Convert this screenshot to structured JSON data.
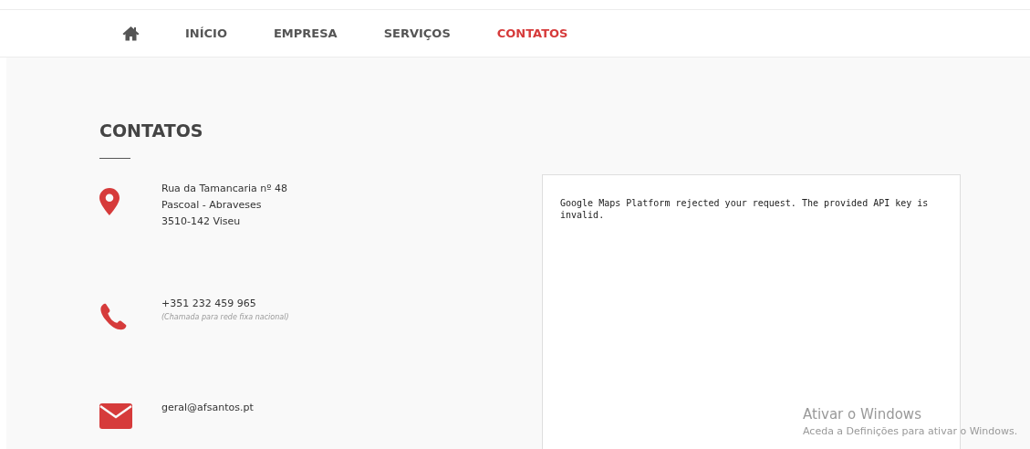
{
  "nav": {
    "items": [
      {
        "kind": "home",
        "selected": false
      },
      {
        "kind": "text",
        "label": "INÍCIO",
        "selected": false
      },
      {
        "kind": "text",
        "label": "EMPRESA",
        "selected": false
      },
      {
        "kind": "text",
        "label": "SERVIÇOS",
        "selected": false
      },
      {
        "kind": "text",
        "label": "CONTATOS",
        "selected": true
      }
    ]
  },
  "heading": "CONTATOS",
  "contacts": [
    {
      "kind": "address",
      "lines": [
        "Rua da Tamancaria nº 48",
        "Pascoal - Abraveses",
        "3510-142 Viseu"
      ]
    },
    {
      "kind": "phone",
      "lines": [
        "+351 232 459 965"
      ],
      "note": "(Chamada para rede fixa nacional)"
    },
    {
      "kind": "email",
      "lines": [
        "geral@afsantos.pt"
      ]
    }
  ],
  "map": {
    "message": "Google Maps Platform rejected your request. The provided API key is invalid."
  },
  "activation_notice": {
    "title": "Ativar o Windows",
    "text": "Aceda a Definições para ativar o Windows."
  }
}
